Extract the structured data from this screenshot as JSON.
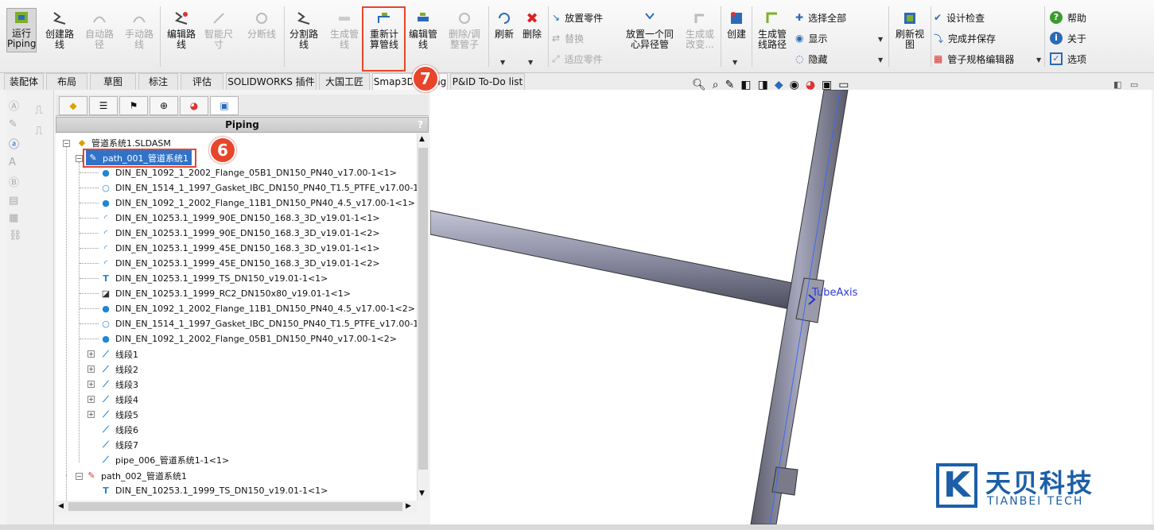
{
  "ribbon": {
    "run_piping": "运行\nPiping",
    "create_route": "创建路\n线",
    "auto_route": "自动路\n径",
    "manual_route": "手动路\n线",
    "edit_route": "编辑路\n线",
    "smart_dim": "智能尺\n寸",
    "split_line": "分断线",
    "split_route": "分割路\n线",
    "generate_pipe": "生成管\n线",
    "recalc_route": "重新计\n算管线",
    "edit_pipe": "编辑管\n线",
    "delete_adjust": "删除/调\n整管子",
    "refresh": "刷新",
    "delete": "删除",
    "place_part": "放置零件",
    "replace": "替换",
    "fit_part": "适应零件",
    "place_concentric": "放置一个同\n心异径管",
    "generate_or_change": "生成或\n改变...",
    "create": "创建",
    "generate_route": "生成管\n线路径",
    "select_all": "选择全部",
    "show": "显示",
    "hide": "隐藏",
    "refresh_view": "刷新视\n图",
    "design_check": "设计检查",
    "finish_save": "完成并保存",
    "spec_editor": "管子规格编辑器",
    "help": "帮助",
    "about": "关于",
    "options": "选项"
  },
  "tabs": [
    "装配体",
    "布局",
    "草图",
    "标注",
    "评估",
    "SOLIDWORKS 插件",
    "大国工匠",
    "Smap3D Piping",
    "P&ID To-Do list"
  ],
  "panel": {
    "title": "Piping",
    "help": "?"
  },
  "tree": {
    "root": "管道系统1.SLDASM",
    "path1": "path_001_管道系统1",
    "items": [
      "DIN_EN_1092_1_2002_Flange_05B1_DN150_PN40_v17.00-1<1>",
      "DIN_EN_1514_1_1997_Gasket_IBC_DN150_PN40_T1.5_PTFE_v17.00-1<1>",
      "DIN_EN_1092_1_2002_Flange_11B1_DN150_PN40_4.5_v17.00-1<1>",
      "DIN_EN_10253.1_1999_90E_DN150_168.3_3D_v19.01-1<1>",
      "DIN_EN_10253.1_1999_90E_DN150_168.3_3D_v19.01-1<2>",
      "DIN_EN_10253.1_1999_45E_DN150_168.3_3D_v19.01-1<1>",
      "DIN_EN_10253.1_1999_45E_DN150_168.3_3D_v19.01-1<2>",
      "DIN_EN_10253.1_1999_TS_DN150_v19.01-1<1>",
      "DIN_EN_10253.1_1999_RC2_DN150x80_v19.01-1<1>",
      "DIN_EN_1092_1_2002_Flange_11B1_DN150_PN40_4.5_v17.00-1<2>",
      "DIN_EN_1514_1_1997_Gasket_IBC_DN150_PN40_T1.5_PTFE_v17.00-1<2>",
      "DIN_EN_1092_1_2002_Flange_05B1_DN150_PN40_v17.00-1<2>"
    ],
    "segments": [
      "线段1",
      "线段2",
      "线段3",
      "线段4",
      "线段5",
      "线段6",
      "线段7"
    ],
    "pipe": "pipe_006_管道系统1-1<1>",
    "path2": "path_002_管道系统1",
    "path2_item": "DIN_EN_10253.1_1999_TS_DN150_v19.01-1<1>"
  },
  "callouts": {
    "six": "6",
    "seven": "7"
  },
  "viewport": {
    "axis_label": "TubeAxis"
  },
  "logo": {
    "name": "天贝科技",
    "sub": "TIANBEI TECH",
    "mark": "K"
  },
  "colors": {
    "accent": "#e8452b",
    "selection": "#3173c9",
    "pipe": "#8f8fa6",
    "logo": "#1c5fa8"
  }
}
